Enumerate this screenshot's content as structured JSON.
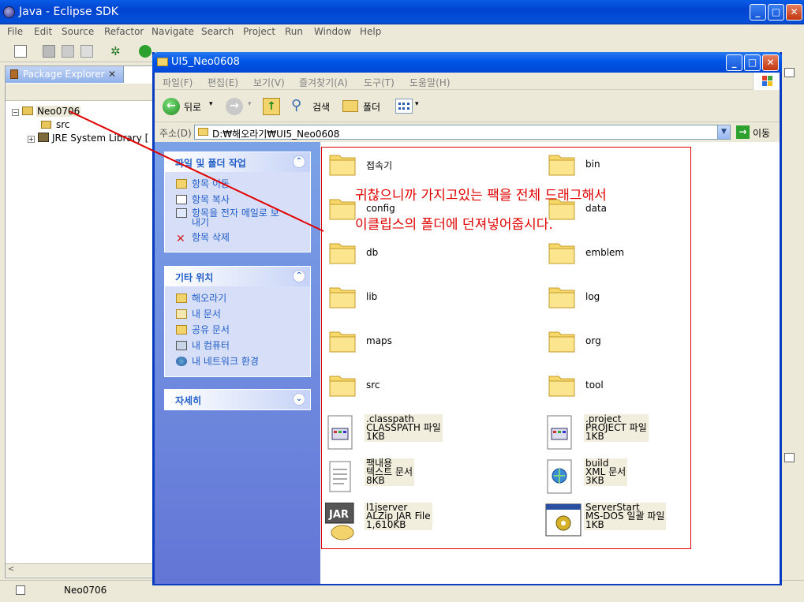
{
  "eclipse": {
    "title": "Java - Eclipse SDK",
    "menu": [
      "File",
      "Edit",
      "Source",
      "Refactor",
      "Navigate",
      "Search",
      "Project",
      "Run",
      "Window",
      "Help"
    ],
    "view_tab": "Package Explorer",
    "tree": {
      "project": "Neo0706",
      "src": "src",
      "jre": "JRE System Library ["
    },
    "status": "Neo0706"
  },
  "explorer": {
    "title": "UI5_Neo0608",
    "menu": [
      "파일(F)",
      "편집(E)",
      "보기(V)",
      "즐겨찾기(A)",
      "도구(T)",
      "도움말(H)"
    ],
    "toolbar": {
      "back": "뒤로",
      "search": "검색",
      "folders": "폴더"
    },
    "address_label": "주소(D)",
    "address": "D:₩해오라기₩UI5_Neo0608",
    "go": "이동",
    "tasks": {
      "file_tasks": {
        "title": "파일 및 폴더 작업",
        "items": [
          "항목 이동",
          "항목 복사",
          "항목을 전자 메일로 보",
          "내기",
          "항목 삭제"
        ]
      },
      "other_places": {
        "title": "기타 위치",
        "items": [
          "해오라기",
          "내 문서",
          "공유 문서",
          "내 컴퓨터",
          "내 네트워크 환경"
        ]
      },
      "details": {
        "title": "자세히"
      }
    },
    "folders": [
      "접속기",
      "bin",
      "config",
      "data",
      "db",
      "emblem",
      "lib",
      "log",
      "maps",
      "org",
      "src",
      "tool"
    ],
    "files": [
      {
        "name": ".classpath",
        "type": "CLASSPATH 파일",
        "size": "1KB"
      },
      {
        "name": ".project",
        "type": "PROJECT 파일",
        "size": "1KB"
      },
      {
        "name": "팩내용",
        "type": "텍스트 문서",
        "size": "8KB"
      },
      {
        "name": "build",
        "type": "XML 문서",
        "size": "3KB"
      },
      {
        "name": "l1jserver",
        "type": "ALZip JAR File",
        "size": "1,610KB"
      },
      {
        "name": "ServerStart",
        "type": "MS-DOS 일괄 파일",
        "size": "1KB"
      }
    ]
  },
  "annotation": {
    "line1": "귀찮으니까 가지고있는 팩을 전체 드래그해서",
    "line2": "이클립스의 폴더에 던져넣어줍시다."
  },
  "colors": {
    "annotation": "#e00000",
    "xp_blue": "#0055e5",
    "task_link": "#215dc6"
  }
}
